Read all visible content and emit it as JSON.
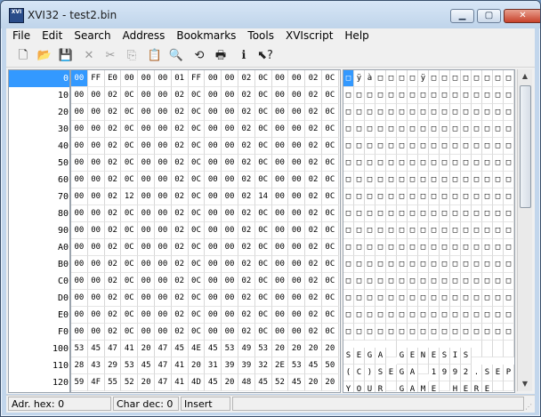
{
  "window": {
    "title": "XVI32 - test2.bin",
    "icon": "app-icon",
    "icon_text": "XVI"
  },
  "menu": [
    "File",
    "Edit",
    "Search",
    "Address",
    "Bookmarks",
    "Tools",
    "XVIscript",
    "Help"
  ],
  "toolbar": [
    {
      "name": "new-file-icon",
      "glyph": "🗋",
      "enabled": true
    },
    {
      "name": "open-folder-icon",
      "glyph": "📂",
      "enabled": true
    },
    {
      "name": "save-disk-icon",
      "glyph": "💾",
      "enabled": true
    },
    {
      "name": "close-file-icon",
      "glyph": "✕",
      "enabled": false
    },
    {
      "name": "cut-icon",
      "glyph": "✂",
      "enabled": false
    },
    {
      "name": "copy-icon",
      "glyph": "⎘",
      "enabled": false
    },
    {
      "name": "paste-icon",
      "glyph": "📋",
      "enabled": true
    },
    {
      "name": "find-icon",
      "glyph": "🔍",
      "enabled": true
    },
    {
      "name": "replace-icon",
      "glyph": "⟲",
      "enabled": true
    },
    {
      "name": "print-icon",
      "glyph": "🖶",
      "enabled": true
    },
    {
      "name": "info-icon",
      "glyph": "ℹ",
      "enabled": true
    },
    {
      "name": "context-help-icon",
      "glyph": "⬉?",
      "enabled": true
    }
  ],
  "addresses": [
    "0",
    "10",
    "20",
    "30",
    "40",
    "50",
    "60",
    "70",
    "80",
    "90",
    "A0",
    "B0",
    "C0",
    "D0",
    "E0",
    "F0",
    "100",
    "110",
    "120"
  ],
  "hex_rows": [
    [
      "00",
      "FF",
      "E0",
      "00",
      "00",
      "00",
      "01",
      "FF",
      "00",
      "00",
      "02",
      "0C",
      "00",
      "00",
      "02",
      "0C"
    ],
    [
      "00",
      "00",
      "02",
      "0C",
      "00",
      "00",
      "02",
      "0C",
      "00",
      "00",
      "02",
      "0C",
      "00",
      "00",
      "02",
      "0C"
    ],
    [
      "00",
      "00",
      "02",
      "0C",
      "00",
      "00",
      "02",
      "0C",
      "00",
      "00",
      "02",
      "0C",
      "00",
      "00",
      "02",
      "0C"
    ],
    [
      "00",
      "00",
      "02",
      "0C",
      "00",
      "00",
      "02",
      "0C",
      "00",
      "00",
      "02",
      "0C",
      "00",
      "00",
      "02",
      "0C"
    ],
    [
      "00",
      "00",
      "02",
      "0C",
      "00",
      "00",
      "02",
      "0C",
      "00",
      "00",
      "02",
      "0C",
      "00",
      "00",
      "02",
      "0C"
    ],
    [
      "00",
      "00",
      "02",
      "0C",
      "00",
      "00",
      "02",
      "0C",
      "00",
      "00",
      "02",
      "0C",
      "00",
      "00",
      "02",
      "0C"
    ],
    [
      "00",
      "00",
      "02",
      "0C",
      "00",
      "00",
      "02",
      "0C",
      "00",
      "00",
      "02",
      "0C",
      "00",
      "00",
      "02",
      "0C"
    ],
    [
      "00",
      "00",
      "02",
      "12",
      "00",
      "00",
      "02",
      "0C",
      "00",
      "00",
      "02",
      "14",
      "00",
      "00",
      "02",
      "0C"
    ],
    [
      "00",
      "00",
      "02",
      "0C",
      "00",
      "00",
      "02",
      "0C",
      "00",
      "00",
      "02",
      "0C",
      "00",
      "00",
      "02",
      "0C"
    ],
    [
      "00",
      "00",
      "02",
      "0C",
      "00",
      "00",
      "02",
      "0C",
      "00",
      "00",
      "02",
      "0C",
      "00",
      "00",
      "02",
      "0C"
    ],
    [
      "00",
      "00",
      "02",
      "0C",
      "00",
      "00",
      "02",
      "0C",
      "00",
      "00",
      "02",
      "0C",
      "00",
      "00",
      "02",
      "0C"
    ],
    [
      "00",
      "00",
      "02",
      "0C",
      "00",
      "00",
      "02",
      "0C",
      "00",
      "00",
      "02",
      "0C",
      "00",
      "00",
      "02",
      "0C"
    ],
    [
      "00",
      "00",
      "02",
      "0C",
      "00",
      "00",
      "02",
      "0C",
      "00",
      "00",
      "02",
      "0C",
      "00",
      "00",
      "02",
      "0C"
    ],
    [
      "00",
      "00",
      "02",
      "0C",
      "00",
      "00",
      "02",
      "0C",
      "00",
      "00",
      "02",
      "0C",
      "00",
      "00",
      "02",
      "0C"
    ],
    [
      "00",
      "00",
      "02",
      "0C",
      "00",
      "00",
      "02",
      "0C",
      "00",
      "00",
      "02",
      "0C",
      "00",
      "00",
      "02",
      "0C"
    ],
    [
      "00",
      "00",
      "02",
      "0C",
      "00",
      "00",
      "02",
      "0C",
      "00",
      "00",
      "02",
      "0C",
      "00",
      "00",
      "02",
      "0C"
    ],
    [
      "53",
      "45",
      "47",
      "41",
      "20",
      "47",
      "45",
      "4E",
      "45",
      "53",
      "49",
      "53",
      "20",
      "20",
      "20",
      "20"
    ],
    [
      "28",
      "43",
      "29",
      "53",
      "45",
      "47",
      "41",
      "20",
      "31",
      "39",
      "39",
      "32",
      "2E",
      "53",
      "45",
      "50"
    ],
    [
      "59",
      "4F",
      "55",
      "52",
      "20",
      "47",
      "41",
      "4D",
      "45",
      "20",
      "48",
      "45",
      "52",
      "45",
      "20",
      "20"
    ]
  ],
  "char_rows": [
    [
      "□",
      "ÿ",
      "à",
      "□",
      "□",
      "□",
      "□",
      "ÿ",
      "□",
      "□",
      "□",
      "□",
      "□",
      "□",
      "□",
      "□"
    ],
    [
      "□",
      "□",
      "□",
      "□",
      "□",
      "□",
      "□",
      "□",
      "□",
      "□",
      "□",
      "□",
      "□",
      "□",
      "□",
      "□"
    ],
    [
      "□",
      "□",
      "□",
      "□",
      "□",
      "□",
      "□",
      "□",
      "□",
      "□",
      "□",
      "□",
      "□",
      "□",
      "□",
      "□"
    ],
    [
      "□",
      "□",
      "□",
      "□",
      "□",
      "□",
      "□",
      "□",
      "□",
      "□",
      "□",
      "□",
      "□",
      "□",
      "□",
      "□"
    ],
    [
      "□",
      "□",
      "□",
      "□",
      "□",
      "□",
      "□",
      "□",
      "□",
      "□",
      "□",
      "□",
      "□",
      "□",
      "□",
      "□"
    ],
    [
      "□",
      "□",
      "□",
      "□",
      "□",
      "□",
      "□",
      "□",
      "□",
      "□",
      "□",
      "□",
      "□",
      "□",
      "□",
      "□"
    ],
    [
      "□",
      "□",
      "□",
      "□",
      "□",
      "□",
      "□",
      "□",
      "□",
      "□",
      "□",
      "□",
      "□",
      "□",
      "□",
      "□"
    ],
    [
      "□",
      "□",
      "□",
      "□",
      "□",
      "□",
      "□",
      "□",
      "□",
      "□",
      "□",
      "□",
      "□",
      "□",
      "□",
      "□"
    ],
    [
      "□",
      "□",
      "□",
      "□",
      "□",
      "□",
      "□",
      "□",
      "□",
      "□",
      "□",
      "□",
      "□",
      "□",
      "□",
      "□"
    ],
    [
      "□",
      "□",
      "□",
      "□",
      "□",
      "□",
      "□",
      "□",
      "□",
      "□",
      "□",
      "□",
      "□",
      "□",
      "□",
      "□"
    ],
    [
      "□",
      "□",
      "□",
      "□",
      "□",
      "□",
      "□",
      "□",
      "□",
      "□",
      "□",
      "□",
      "□",
      "□",
      "□",
      "□"
    ],
    [
      "□",
      "□",
      "□",
      "□",
      "□",
      "□",
      "□",
      "□",
      "□",
      "□",
      "□",
      "□",
      "□",
      "□",
      "□",
      "□"
    ],
    [
      "□",
      "□",
      "□",
      "□",
      "□",
      "□",
      "□",
      "□",
      "□",
      "□",
      "□",
      "□",
      "□",
      "□",
      "□",
      "□"
    ],
    [
      "□",
      "□",
      "□",
      "□",
      "□",
      "□",
      "□",
      "□",
      "□",
      "□",
      "□",
      "□",
      "□",
      "□",
      "□",
      "□"
    ],
    [
      "□",
      "□",
      "□",
      "□",
      "□",
      "□",
      "□",
      "□",
      "□",
      "□",
      "□",
      "□",
      "□",
      "□",
      "□",
      "□"
    ],
    [
      "□",
      "□",
      "□",
      "□",
      "□",
      "□",
      "□",
      "□",
      "□",
      "□",
      "□",
      "□",
      "□",
      "□",
      "□",
      "□"
    ],
    [
      "S",
      "E",
      "G",
      "A",
      " ",
      "G",
      "E",
      "N",
      "E",
      "S",
      "I",
      "S",
      " ",
      " ",
      " ",
      " "
    ],
    [
      "(",
      "C",
      ")",
      "S",
      "E",
      "G",
      "A",
      " ",
      "1",
      "9",
      "9",
      "2",
      ".",
      "S",
      "E",
      "P"
    ],
    [
      "Y",
      "O",
      "U",
      "R",
      " ",
      "G",
      "A",
      "M",
      "E",
      " ",
      "H",
      "E",
      "R",
      "E",
      " ",
      " "
    ]
  ],
  "selection": {
    "row": 0,
    "col": 0
  },
  "status": {
    "adr_hex": "Adr. hex: 0",
    "char_dec": "Char dec: 0",
    "mode": "Insert"
  },
  "colors": {
    "selection": "#3399ff",
    "title_bar": "#c2d6ec",
    "close_button": "#c8422b"
  }
}
